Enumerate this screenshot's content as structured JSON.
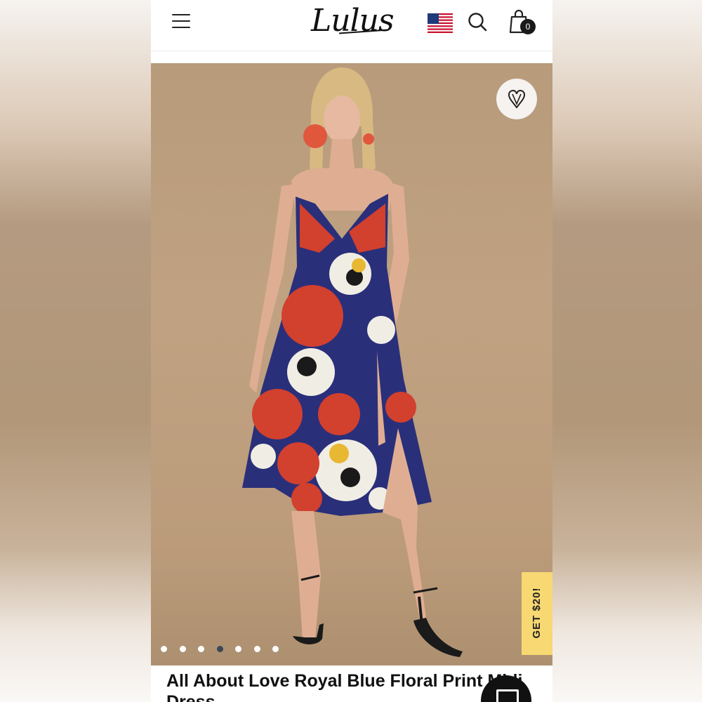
{
  "header": {
    "logo": "Lulus",
    "menu_icon": "hamburger-menu-icon",
    "flag_icon": "us-flag-icon",
    "search_icon": "search-icon",
    "bag_icon": "shopping-bag-icon",
    "bag_count": "0"
  },
  "hero": {
    "favorite_icon": "heart-icon",
    "promo_tab": "GET $20!",
    "carousel_dots_total": 7,
    "carousel_active_index": 3
  },
  "product": {
    "title": "All About Love Royal Blue Floral Print Midi Dress"
  },
  "chat": {
    "icon": "chat-icon"
  },
  "colors": {
    "promo_yellow": "#f7d872",
    "dot_active": "#3b4656",
    "background_tan": "#bc9e7e",
    "dress_navy": "#2a2f7a",
    "flower_red": "#d2402e"
  }
}
